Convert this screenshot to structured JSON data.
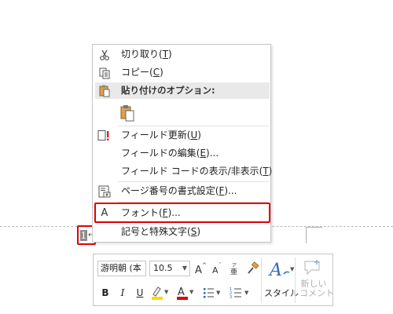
{
  "context_menu": {
    "items": [
      {
        "name": "cut",
        "label": "切り取り(",
        "key": "T",
        "suffix": ")"
      },
      {
        "name": "copy",
        "label": "コピー(",
        "key": "C",
        "suffix": ")"
      },
      {
        "name": "update-field",
        "label": "フィールド更新(",
        "key": "U",
        "suffix": ")"
      },
      {
        "name": "edit-field",
        "label": "フィールドの編集(",
        "key": "E",
        "suffix": ")..."
      },
      {
        "name": "toggle-field-codes",
        "label": "フィールド コードの表示/非表示(",
        "key": "T",
        "suffix": ")"
      },
      {
        "name": "format-page-numbers",
        "label": "ページ番号の書式設定(",
        "key": "F",
        "suffix": ")..."
      },
      {
        "name": "font",
        "label": "フォント(",
        "key": "F",
        "suffix": ")..."
      },
      {
        "name": "symbol",
        "label": "記号と特殊文字(",
        "key": "S",
        "suffix": ")"
      }
    ],
    "paste_options_label": "貼り付けのオプション:"
  },
  "document": {
    "page_number": "1",
    "paragraph_mark": "↵"
  },
  "mini_toolbar": {
    "font_name": "游明朝 (本",
    "font_size": "10.5",
    "bold": "B",
    "italic": "I",
    "underline": "U",
    "style_label": "スタイル",
    "comment_label_line1": "新しい",
    "comment_label_line2": "コメント",
    "highlight_color": "#ffd800",
    "font_color": "#e00000"
  },
  "colors": {
    "annotation_red": "#e00000",
    "menu_border": "#c6c6c6",
    "section_header_bg": "#e9e9e9",
    "style_icon_blue": "#2f6bb5"
  }
}
